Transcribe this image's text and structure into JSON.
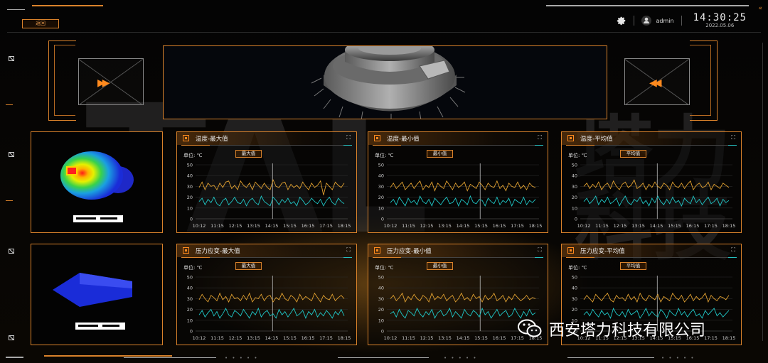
{
  "header": {
    "back_label": "返回",
    "user_label": "admin",
    "time": "14:30:25",
    "date": "2022.05.06",
    "collapse_glyph": "«"
  },
  "icons": {
    "settings": "gear-icon",
    "user": "user-icon",
    "expand": "expand-icon",
    "panel": "panel-icon",
    "prev": "fast-forward-icon",
    "next": "fast-rewind-icon"
  },
  "watermark": {
    "letters": "TAL",
    "chars": [
      "塔",
      "力",
      "科",
      "技"
    ]
  },
  "colors": {
    "accent": "#d9822b",
    "series_orange": "#e0a030",
    "series_cyan": "#1fc7c7"
  },
  "panels": [
    {
      "title": "温度-最大值",
      "unit": "单位: ℃",
      "tag": "最大值",
      "chart_data": {
        "type": "line",
        "x": [
          "10:12",
          "11:15",
          "12:15",
          "13:15",
          "14:15",
          "15:15",
          "16:15",
          "17:15",
          "18:15"
        ],
        "yticks": [
          "50",
          "40",
          "30",
          "20",
          "10",
          "0"
        ],
        "ylim": [
          0,
          50
        ],
        "cursor_x": 4.05,
        "series": [
          {
            "values": [
              29,
              34,
              27,
              33,
              30,
              31,
              27,
              33,
              29,
              34,
              35,
              28,
              31,
              27,
              35,
              31,
              29,
              33,
              27,
              34,
              31,
              28,
              33,
              29,
              27,
              36,
              30,
              29,
              33,
              34,
              27,
              32,
              29,
              31,
              28,
              34,
              30,
              27,
              33,
              29,
              31,
              35,
              22,
              33,
              30,
              27,
              34,
              31,
              29,
              33
            ]
          },
          {
            "values": [
              16,
              19,
              13,
              18,
              15,
              20,
              14,
              12,
              17,
              19,
              13,
              16,
              20,
              15,
              14,
              18,
              12,
              17,
              19,
              15,
              13,
              21,
              16,
              14,
              12,
              20,
              17,
              13,
              18,
              15,
              19,
              14,
              16,
              12,
              20,
              17,
              13,
              15,
              19,
              16,
              14,
              18,
              12,
              17,
              20,
              15,
              13,
              19,
              16,
              14
            ]
          }
        ]
      }
    },
    {
      "title": "温度-最小值",
      "unit": "单位: ℃",
      "tag": "最小值",
      "chart_data": {
        "type": "line",
        "x": [
          "10:12",
          "11:15",
          "12:15",
          "13:15",
          "14:15",
          "15:15",
          "16:15",
          "17:15",
          "18:15"
        ],
        "yticks": [
          "50",
          "40",
          "30",
          "20",
          "10",
          "0"
        ],
        "ylim": [
          0,
          50
        ],
        "cursor_x": 4.95,
        "series": [
          {
            "values": [
              29,
              33,
              28,
              31,
              34,
              27,
              30,
              33,
              28,
              32,
              35,
              27,
              31,
              29,
              34,
              26,
              33,
              30,
              28,
              35,
              31,
              27,
              33,
              29,
              31,
              34,
              26,
              32,
              30,
              28,
              34,
              31,
              27,
              33,
              30,
              29,
              35,
              28,
              31,
              26,
              33,
              30,
              29,
              34,
              28,
              31,
              27,
              33,
              30,
              29
            ]
          },
          {
            "values": [
              15,
              18,
              13,
              20,
              16,
              12,
              19,
              15,
              17,
              13,
              21,
              16,
              14,
              18,
              12,
              19,
              16,
              13,
              17,
              20,
              14,
              15,
              19,
              12,
              18,
              16,
              13,
              21,
              15,
              14,
              18,
              17,
              12,
              19,
              16,
              14,
              20,
              13,
              17,
              15,
              19,
              12,
              18,
              16,
              14,
              20,
              13,
              17,
              15,
              18
            ]
          }
        ]
      }
    },
    {
      "title": "温度-平均值",
      "unit": "单位: ℃",
      "tag": "平均值",
      "chart_data": {
        "type": "line",
        "x": [
          "10:12",
          "11:15",
          "12:15",
          "13:15",
          "14:15",
          "15:15",
          "16:15",
          "17:15",
          "18:15"
        ],
        "yticks": [
          "50",
          "40",
          "30",
          "20",
          "10",
          "0"
        ],
        "ylim": [
          0,
          50
        ],
        "cursor_x": 4.05,
        "series": [
          {
            "values": [
              30,
              33,
              28,
              32,
              29,
              34,
              27,
              31,
              33,
              28,
              35,
              30,
              27,
              32,
              34,
              29,
              31,
              36,
              28,
              30,
              33,
              27,
              32,
              29,
              34,
              30,
              28,
              33,
              31,
              27,
              34,
              30,
              29,
              33,
              28,
              32,
              35,
              27,
              31,
              33,
              29,
              30,
              34,
              27,
              32,
              30,
              28,
              33,
              31,
              29
            ]
          },
          {
            "values": [
              16,
              19,
              14,
              17,
              21,
              13,
              18,
              15,
              20,
              14,
              16,
              19,
              12,
              17,
              21,
              15,
              13,
              18,
              16,
              20,
              14,
              17,
              12,
              19,
              15,
              21,
              16,
              13,
              18,
              14,
              20,
              15,
              17,
              12,
              19,
              16,
              14,
              21,
              15,
              18,
              13,
              17,
              20,
              14,
              16,
              19,
              12,
              18,
              15,
              17
            ]
          }
        ]
      }
    },
    {
      "title": "压力应变-最大值",
      "unit": "单位: ℃",
      "tag": "最大值",
      "chart_data": {
        "type": "line",
        "x": [
          "10:12",
          "11:15",
          "12:15",
          "13:15",
          "14:15",
          "15:15",
          "16:15",
          "17:15",
          "18:15"
        ],
        "yticks": [
          "50",
          "40",
          "30",
          "20",
          "10",
          "0"
        ],
        "ylim": [
          0,
          50
        ],
        "cursor_x": 4.05,
        "series": [
          {
            "values": [
              29,
              34,
              30,
              27,
              33,
              31,
              28,
              35,
              29,
              32,
              27,
              34,
              30,
              31,
              28,
              33,
              29,
              35,
              27,
              31,
              30,
              34,
              28,
              32,
              33,
              27,
              31,
              29,
              35,
              30,
              28,
              33,
              31,
              27,
              34,
              29,
              32,
              30,
              28,
              35,
              31,
              27,
              33,
              30,
              29,
              34,
              28,
              31,
              33,
              30
            ]
          },
          {
            "values": [
              15,
              19,
              13,
              17,
              20,
              14,
              18,
              12,
              16,
              21,
              15,
              13,
              19,
              17,
              14,
              20,
              16,
              12,
              18,
              15,
              21,
              13,
              17,
              19,
              14,
              16,
              12,
              20,
              15,
              18,
              13,
              17,
              21,
              14,
              16,
              19,
              12,
              18,
              15,
              20,
              13,
              17,
              14,
              19,
              16,
              12,
              18,
              15,
              20,
              14
            ]
          }
        ]
      }
    },
    {
      "title": "压力应变-最小值",
      "unit": "单位: ℃",
      "tag": "最小值",
      "chart_data": {
        "type": "line",
        "x": [
          "10:12",
          "11:15",
          "12:15",
          "13:15",
          "14:15",
          "15:15",
          "16:15",
          "17:15",
          "18:15"
        ],
        "yticks": [
          "50",
          "40",
          "30",
          "20",
          "10",
          "0"
        ],
        "ylim": [
          0,
          50
        ],
        "cursor_x": 4.95,
        "series": [
          {
            "values": [
              30,
              33,
              28,
              31,
              35,
              27,
              32,
              29,
              34,
              30,
              28,
              33,
              31,
              27,
              35,
              29,
              32,
              30,
              34,
              28,
              31,
              33,
              27,
              30,
              35,
              29,
              31,
              28,
              34,
              30,
              32,
              27,
              33,
              29,
              31,
              35,
              28,
              30,
              33,
              27,
              32,
              29,
              34,
              31,
              28,
              30,
              33,
              29,
              31,
              30
            ]
          },
          {
            "values": [
              16,
              18,
              13,
              20,
              15,
              12,
              19,
              17,
              14,
              21,
              16,
              13,
              18,
              15,
              20,
              12,
              17,
              19,
              14,
              16,
              21,
              13,
              18,
              15,
              12,
              20,
              16,
              14,
              19,
              17,
              13,
              21,
              15,
              18,
              12,
              16,
              20,
              14,
              17,
              19,
              13,
              15,
              21,
              16,
              12,
              18,
              14,
              20,
              15,
              17
            ]
          }
        ]
      }
    },
    {
      "title": "压力应变-平均值",
      "unit": "单位: ℃",
      "tag": "平均值",
      "chart_data": {
        "type": "line",
        "x": [
          "10:12",
          "11:15",
          "12:15",
          "13:15",
          "14:15",
          "15:15",
          "16:15",
          "17:15",
          "18:15"
        ],
        "yticks": [
          "50",
          "40",
          "30",
          "20",
          "10",
          "0"
        ],
        "ylim": [
          0,
          50
        ],
        "cursor_x": 4.05,
        "series": [
          {
            "values": [
              29,
              33,
              30,
              27,
              34,
              31,
              28,
              32,
              35,
              29,
              27,
              33,
              30,
              31,
              28,
              34,
              29,
              32,
              27,
              35,
              30,
              28,
              33,
              31,
              29,
              34,
              27,
              32,
              30,
              28,
              35,
              31,
              29,
              33,
              27,
              30,
              34,
              28,
              32,
              29,
              31,
              35,
              27,
              33,
              30,
              28,
              32,
              31,
              29,
              33
            ]
          },
          {
            "values": [
              15,
              18,
              14,
              20,
              16,
              13,
              19,
              15,
              17,
              12,
              21,
              16,
              14,
              18,
              13,
              20,
              15,
              17,
              19,
              12,
              16,
              21,
              14,
              18,
              15,
              13,
              20,
              17,
              12,
              19,
              16,
              14,
              21,
              15,
              18,
              13,
              17,
              20,
              14,
              16,
              12,
              19,
              15,
              18,
              21,
              14,
              17,
              13,
              16,
              19
            ]
          }
        ]
      }
    }
  ],
  "company": {
    "name": "西安塔力科技有限公司"
  },
  "footer": {
    "dots_glyph": "• • • • •"
  }
}
